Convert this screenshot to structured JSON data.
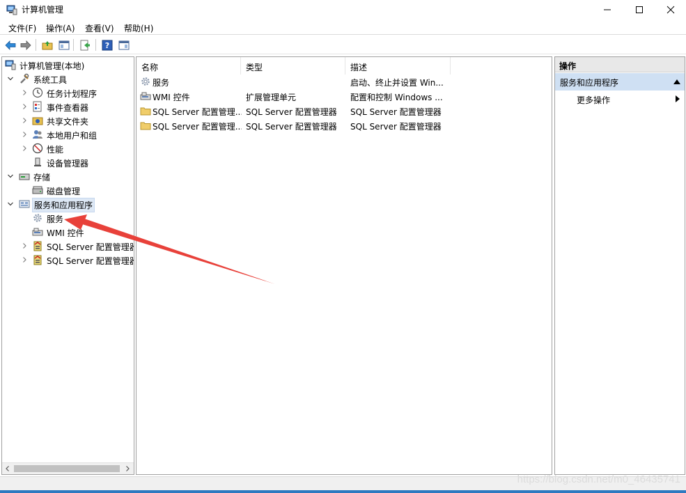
{
  "window": {
    "title": "计算机管理",
    "icon": "computer-management-icon"
  },
  "menu": {
    "file": "文件(F)",
    "action": "操作(A)",
    "view": "查看(V)",
    "help": "帮助(H)"
  },
  "toolbar": {
    "buttons": [
      "back-icon",
      "forward-icon",
      "up-folder-icon",
      "show-hide-tree-icon",
      "export-list-icon",
      "help-icon",
      "show-hide-action-pane-icon"
    ]
  },
  "tree": {
    "root": "计算机管理(本地)",
    "system_tools": "系统工具",
    "task_scheduler": "任务计划程序",
    "event_viewer": "事件查看器",
    "shared_folders": "共享文件夹",
    "local_users": "本地用户和组",
    "performance": "性能",
    "device_manager": "设备管理器",
    "storage": "存储",
    "disk_management": "磁盘管理",
    "services_apps": "服务和应用程序",
    "services": "服务",
    "wmi": "WMI 控件",
    "sql1": "SQL Server 配置管理器",
    "sql2": "SQL Server 配置管理器"
  },
  "list": {
    "columns": [
      "名称",
      "类型",
      "描述"
    ],
    "rows": [
      {
        "name": "服务",
        "type": "",
        "desc": "启动、终止并设置 Win..."
      },
      {
        "name": "WMI 控件",
        "type": "扩展管理单元",
        "desc": "配置和控制 Windows ..."
      },
      {
        "name": "SQL Server 配置管理...",
        "type": "SQL Server 配置管理器",
        "desc": "SQL Server 配置管理器"
      },
      {
        "name": "SQL Server 配置管理...",
        "type": "SQL Server 配置管理器",
        "desc": "SQL Server 配置管理器"
      }
    ]
  },
  "actions": {
    "header": "操作",
    "section": "服务和应用程序",
    "more": "更多操作"
  },
  "watermark": "https://blog.csdn.net/m0_46435741",
  "colors": {
    "selection": "#dde8f5",
    "action_section": "#cfe0f3",
    "annotation_arrow": "#e8413a",
    "accent": "#2e79c0"
  }
}
